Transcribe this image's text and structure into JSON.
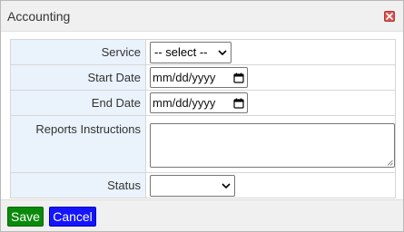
{
  "dialog": {
    "title": "Accounting",
    "close_icon": "close-icon"
  },
  "form": {
    "service": {
      "label": "Service",
      "selected": "-- select --"
    },
    "start_date": {
      "label": "Start Date",
      "placeholder": "mm/dd/yyyy"
    },
    "end_date": {
      "label": "End Date",
      "placeholder": "mm/dd/yyyy"
    },
    "reports_instructions": {
      "label": "Reports Instructions",
      "value": ""
    },
    "status": {
      "label": "Status",
      "selected": ""
    }
  },
  "footer": {
    "save_label": "Save",
    "cancel_label": "Cancel"
  },
  "colors": {
    "label_bg": "#eaf2fb",
    "save_bg": "#0a8a0a",
    "cancel_bg": "#1414ff",
    "close_bg": "#d9534f"
  }
}
